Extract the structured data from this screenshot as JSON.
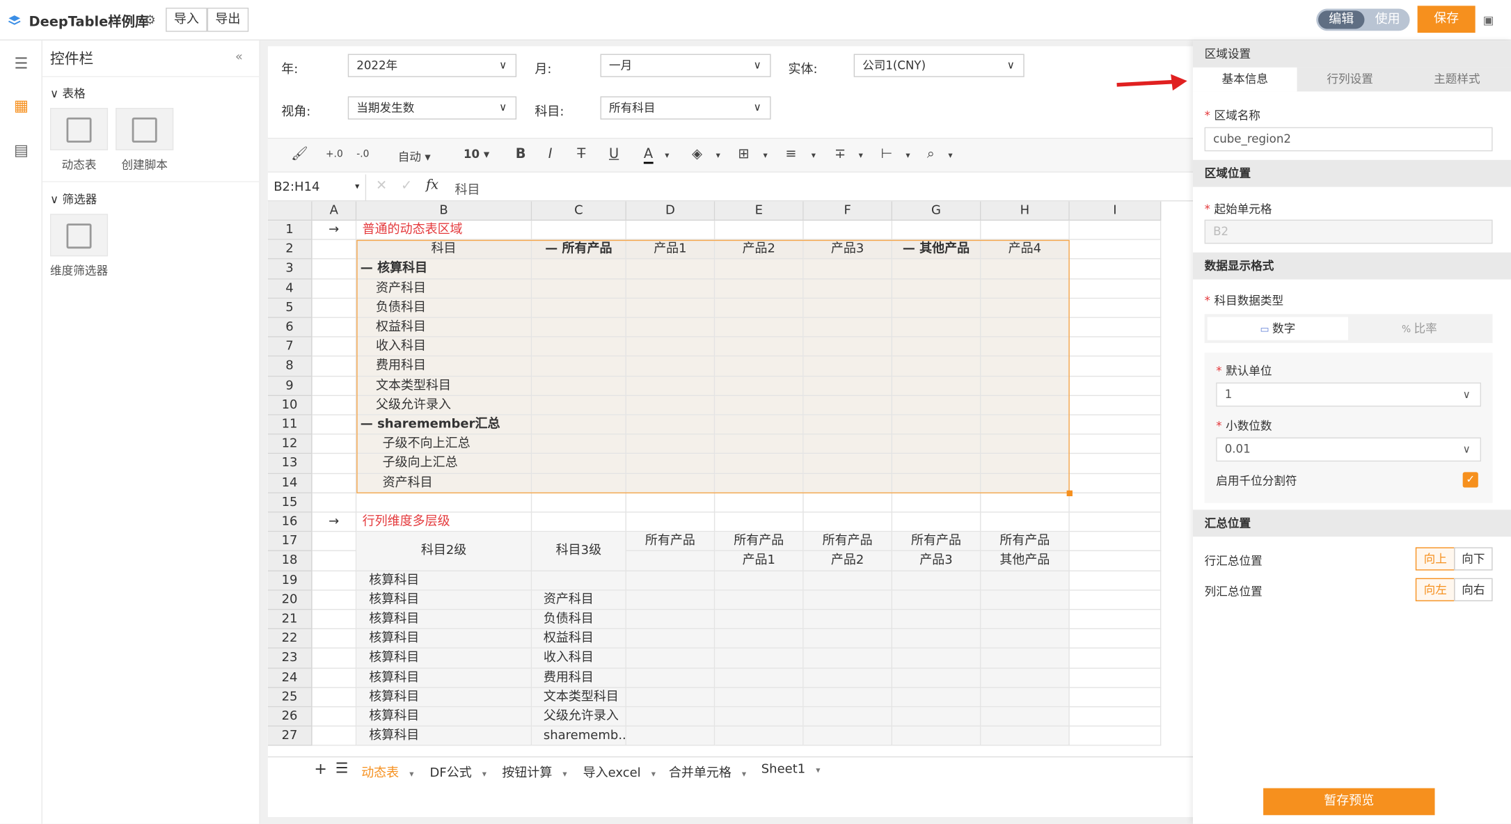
{
  "app": {
    "title": "DeepTable样例库",
    "import_label": "导入",
    "export_label": "导出",
    "mode_edit": "编辑",
    "mode_use": "使用",
    "save_label": "保存"
  },
  "controlbar": {
    "title": "控件栏",
    "group_table": "表格",
    "tile_dynamic": "动态表",
    "tile_script": "创建脚本",
    "group_filter": "筛选器",
    "tile_dim_filter": "维度筛选器"
  },
  "filters": {
    "year_label": "年:",
    "year_value": "2022年",
    "month_label": "月:",
    "month_value": "一月",
    "entity_label": "实体:",
    "entity_value": "公司1(CNY)",
    "view_label": "视角:",
    "view_value": "当期发生数",
    "subject_label": "科目:",
    "subject_value": "所有科目"
  },
  "toolbar": {
    "auto_label": "自动",
    "font_size": "10"
  },
  "formula": {
    "cell_ref": "B2:H14",
    "fx": "fx",
    "content": "科目"
  },
  "columns": [
    "A",
    "B",
    "C",
    "D",
    "E",
    "F",
    "G",
    "H",
    "I"
  ],
  "rows": [
    "1",
    "2",
    "3",
    "4",
    "5",
    "6",
    "7",
    "8",
    "9",
    "10",
    "11",
    "12",
    "13",
    "14",
    "15",
    "16",
    "17",
    "18",
    "19",
    "20",
    "21",
    "22",
    "23",
    "24",
    "25",
    "26",
    "27"
  ],
  "cells": {
    "r1_arrow": "→",
    "r1_title": "普通的动态表区域",
    "r2_b": "科目",
    "r2_c": "— 所有产品",
    "r2_d": "产品1",
    "r2_e": "产品2",
    "r2_f": "产品3",
    "r2_g": "— 其他产品",
    "r2_h": "产品4",
    "r3_b": "— 核算科目",
    "r4_b": "资产科目",
    "r5_b": "负债科目",
    "r6_b": "权益科目",
    "r7_b": "收入科目",
    "r8_b": "费用科目",
    "r9_b": "文本类型科目",
    "r10_b": "父级允许录入",
    "r11_b": "— sharemember汇总",
    "r12_b": "子级不向上汇总",
    "r13_b": "子级向上汇总",
    "r14_b": "资产科目",
    "r16_arrow": "→",
    "r16_title": "行列维度多层级",
    "r17_b": "科目2级",
    "r17_c": "科目3级",
    "r17_d": "所有产品",
    "r17_e": "所有产品",
    "r17_f": "所有产品",
    "r17_g": "所有产品",
    "r17_h": "所有产品",
    "r18_e": "产品1",
    "r18_f": "产品2",
    "r18_g": "产品3",
    "r18_h": "其他产品",
    "r19_b": "核算科目",
    "r20_b": "核算科目",
    "r20_c": "资产科目",
    "r21_b": "核算科目",
    "r21_c": "负债科目",
    "r22_b": "核算科目",
    "r22_c": "权益科目",
    "r23_b": "核算科目",
    "r23_c": "收入科目",
    "r24_b": "核算科目",
    "r24_c": "费用科目",
    "r25_b": "核算科目",
    "r25_c": "文本类型科目",
    "r26_b": "核算科目",
    "r26_c": "父级允许录入",
    "r27_b": "核算科目",
    "r27_c": "sharememb..."
  },
  "sheets": [
    "动态表",
    "DF公式",
    "按钮计算",
    "导入excel",
    "合并单元格",
    "Sheet1"
  ],
  "panel": {
    "section_region": "区域设置",
    "tab_basic": "基本信息",
    "tab_rowcol": "行列设置",
    "tab_theme": "主题样式",
    "region_name_label": "区域名称",
    "region_name_value": "cube_region2",
    "section_position": "区域位置",
    "start_cell_label": "起始单元格",
    "start_cell_value": "B2",
    "section_format": "数据显示格式",
    "data_type_label": "科目数据类型",
    "type_number": "数字",
    "type_ratio": "比率",
    "unit_label": "默认单位",
    "unit_value": "1",
    "decimal_label": "小数位数",
    "decimal_value": "0.01",
    "thousand_label": "启用千位分割符",
    "section_summary": "汇总位置",
    "row_summary_label": "行汇总位置",
    "row_up": "向上",
    "row_down": "向下",
    "col_summary_label": "列汇总位置",
    "col_left": "向左",
    "col_right": "向右",
    "preview_label": "暂存预览"
  }
}
